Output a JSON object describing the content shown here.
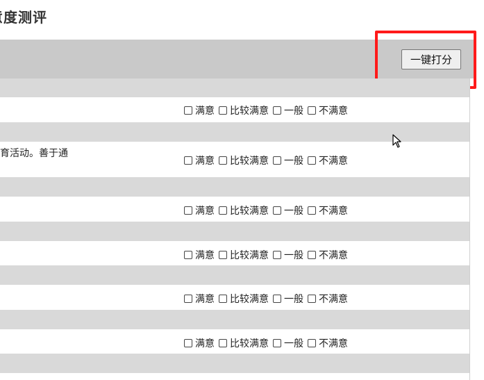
{
  "page": {
    "title": "意度测评"
  },
  "toolbar": {
    "one_click_label": "一键打分"
  },
  "options": [
    "满意",
    "比较满意",
    "一般",
    "不满意"
  ],
  "rows": [
    {
      "text": ""
    },
    {
      "text": "育活动。善于通"
    },
    {
      "text": ""
    },
    {
      "text": ""
    },
    {
      "text": ""
    },
    {
      "text": ""
    }
  ],
  "colors": {
    "highlight": "#ff1a1a",
    "header_bg": "#c9c9c9",
    "band_bg": "#d9d9d9"
  }
}
